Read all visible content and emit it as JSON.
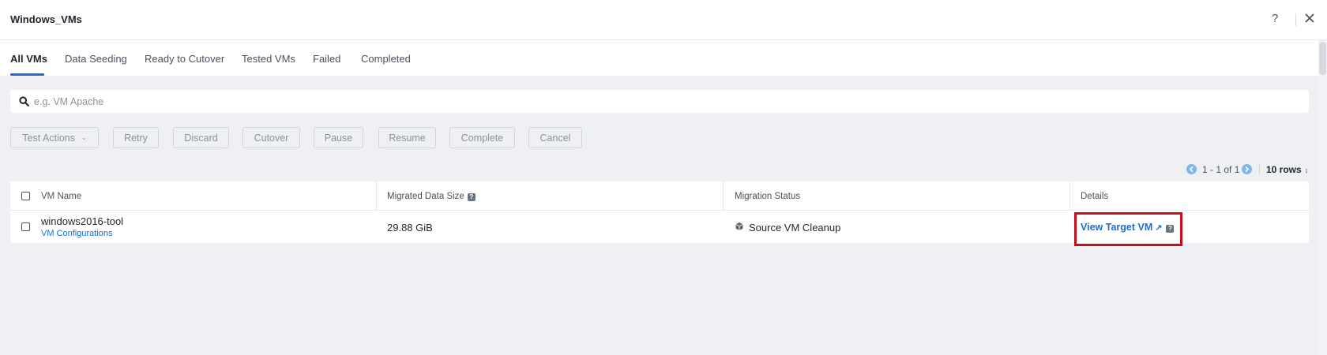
{
  "window": {
    "title": "Windows_VMs",
    "help_label": "?"
  },
  "tabs": [
    {
      "label": "All VMs",
      "active": true
    },
    {
      "label": "Data Seeding"
    },
    {
      "label": "Ready to Cutover"
    },
    {
      "label": "Tested VMs"
    },
    {
      "label": "Failed"
    },
    {
      "label": "Completed"
    }
  ],
  "search": {
    "placeholder": "e.g. VM Apache",
    "value": ""
  },
  "actions": {
    "test_actions": "Test Actions",
    "retry": "Retry",
    "discard": "Discard",
    "cutover": "Cutover",
    "pause": "Pause",
    "resume": "Resume",
    "complete": "Complete",
    "cancel": "Cancel"
  },
  "pagination": {
    "range": "1 - 1 of 1",
    "rows": "10 rows"
  },
  "table": {
    "columns": [
      "VM Name",
      "Migrated Data Size",
      "Migration Status",
      "Details"
    ],
    "rows": [
      {
        "vm_name": "windows2016-tool",
        "config_link": "VM Configurations",
        "size": "29.88 GiB",
        "status": "Source VM Cleanup",
        "details_link": "View Target VM"
      }
    ]
  },
  "colors": {
    "accent": "#1b6ed6",
    "highlight": "#c4101b"
  },
  "icons": [
    "help-icon",
    "close-icon",
    "search-icon",
    "chevron-down-icon",
    "prev-page-icon",
    "next-page-icon",
    "info-icon",
    "cube-icon",
    "external-link-icon"
  ]
}
